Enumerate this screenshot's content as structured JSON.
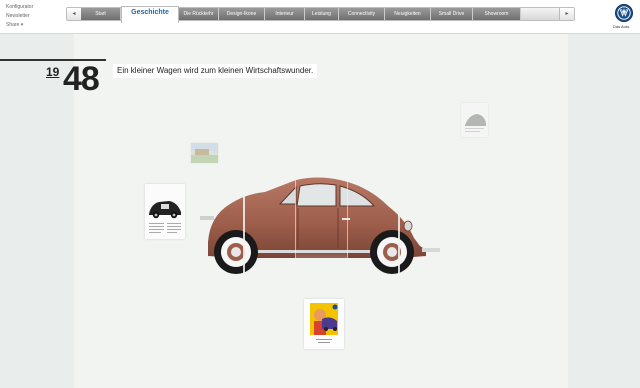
{
  "header": {
    "links": [
      "Konfigurator",
      "Newsletter",
      "Share"
    ],
    "nav_prev": "◂",
    "nav_next": "▸",
    "tabs": [
      {
        "label": "Start",
        "state": "dark"
      },
      {
        "label": "Geschichte",
        "state": "active"
      },
      {
        "label": "Die Rückkehr",
        "state": "dark"
      },
      {
        "label": "Design-Ikone",
        "state": "dark"
      },
      {
        "label": "Interieur",
        "state": "dark"
      },
      {
        "label": "Leistung",
        "state": "dark"
      },
      {
        "label": "Connectivity",
        "state": "dark"
      },
      {
        "label": "Neuigkeiten",
        "state": "dark"
      },
      {
        "label": "Small Drive",
        "state": "dark"
      },
      {
        "label": "Showroom",
        "state": "dark"
      }
    ],
    "brand_tagline": "Das Auto.",
    "accent": "#1a6aa7"
  },
  "main": {
    "year_prefix": "19",
    "year_suffix": "48",
    "headline": "Ein kleiner Wagen wird zum kleinen Wirtschaftswunder.",
    "car_color": "#a0634e"
  }
}
